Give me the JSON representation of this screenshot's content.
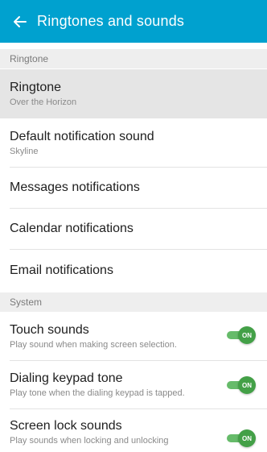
{
  "appbar": {
    "title": "Ringtones and sounds",
    "back_icon": "arrow-left-icon"
  },
  "sections": {
    "ringtone": "Ringtone",
    "system": "System"
  },
  "items": {
    "ringtone": {
      "title": "Ringtone",
      "subtitle": "Over the Horizon"
    },
    "default_notification": {
      "title": "Default notification sound",
      "subtitle": "Skyline"
    },
    "messages": {
      "title": "Messages notifications"
    },
    "calendar": {
      "title": "Calendar notifications"
    },
    "email": {
      "title": "Email notifications"
    },
    "touch": {
      "title": "Touch sounds",
      "subtitle": "Play sound when making screen selection.",
      "toggle": "ON"
    },
    "dialing": {
      "title": "Dialing keypad tone",
      "subtitle": "Play tone when the dialing keypad is tapped.",
      "toggle": "ON"
    },
    "screen_lock": {
      "title": "Screen lock sounds",
      "subtitle": "Play sounds when locking and unlocking",
      "toggle": "ON"
    }
  },
  "colors": {
    "appbar": "#00a1cf",
    "toggle_on": "#43a047"
  }
}
